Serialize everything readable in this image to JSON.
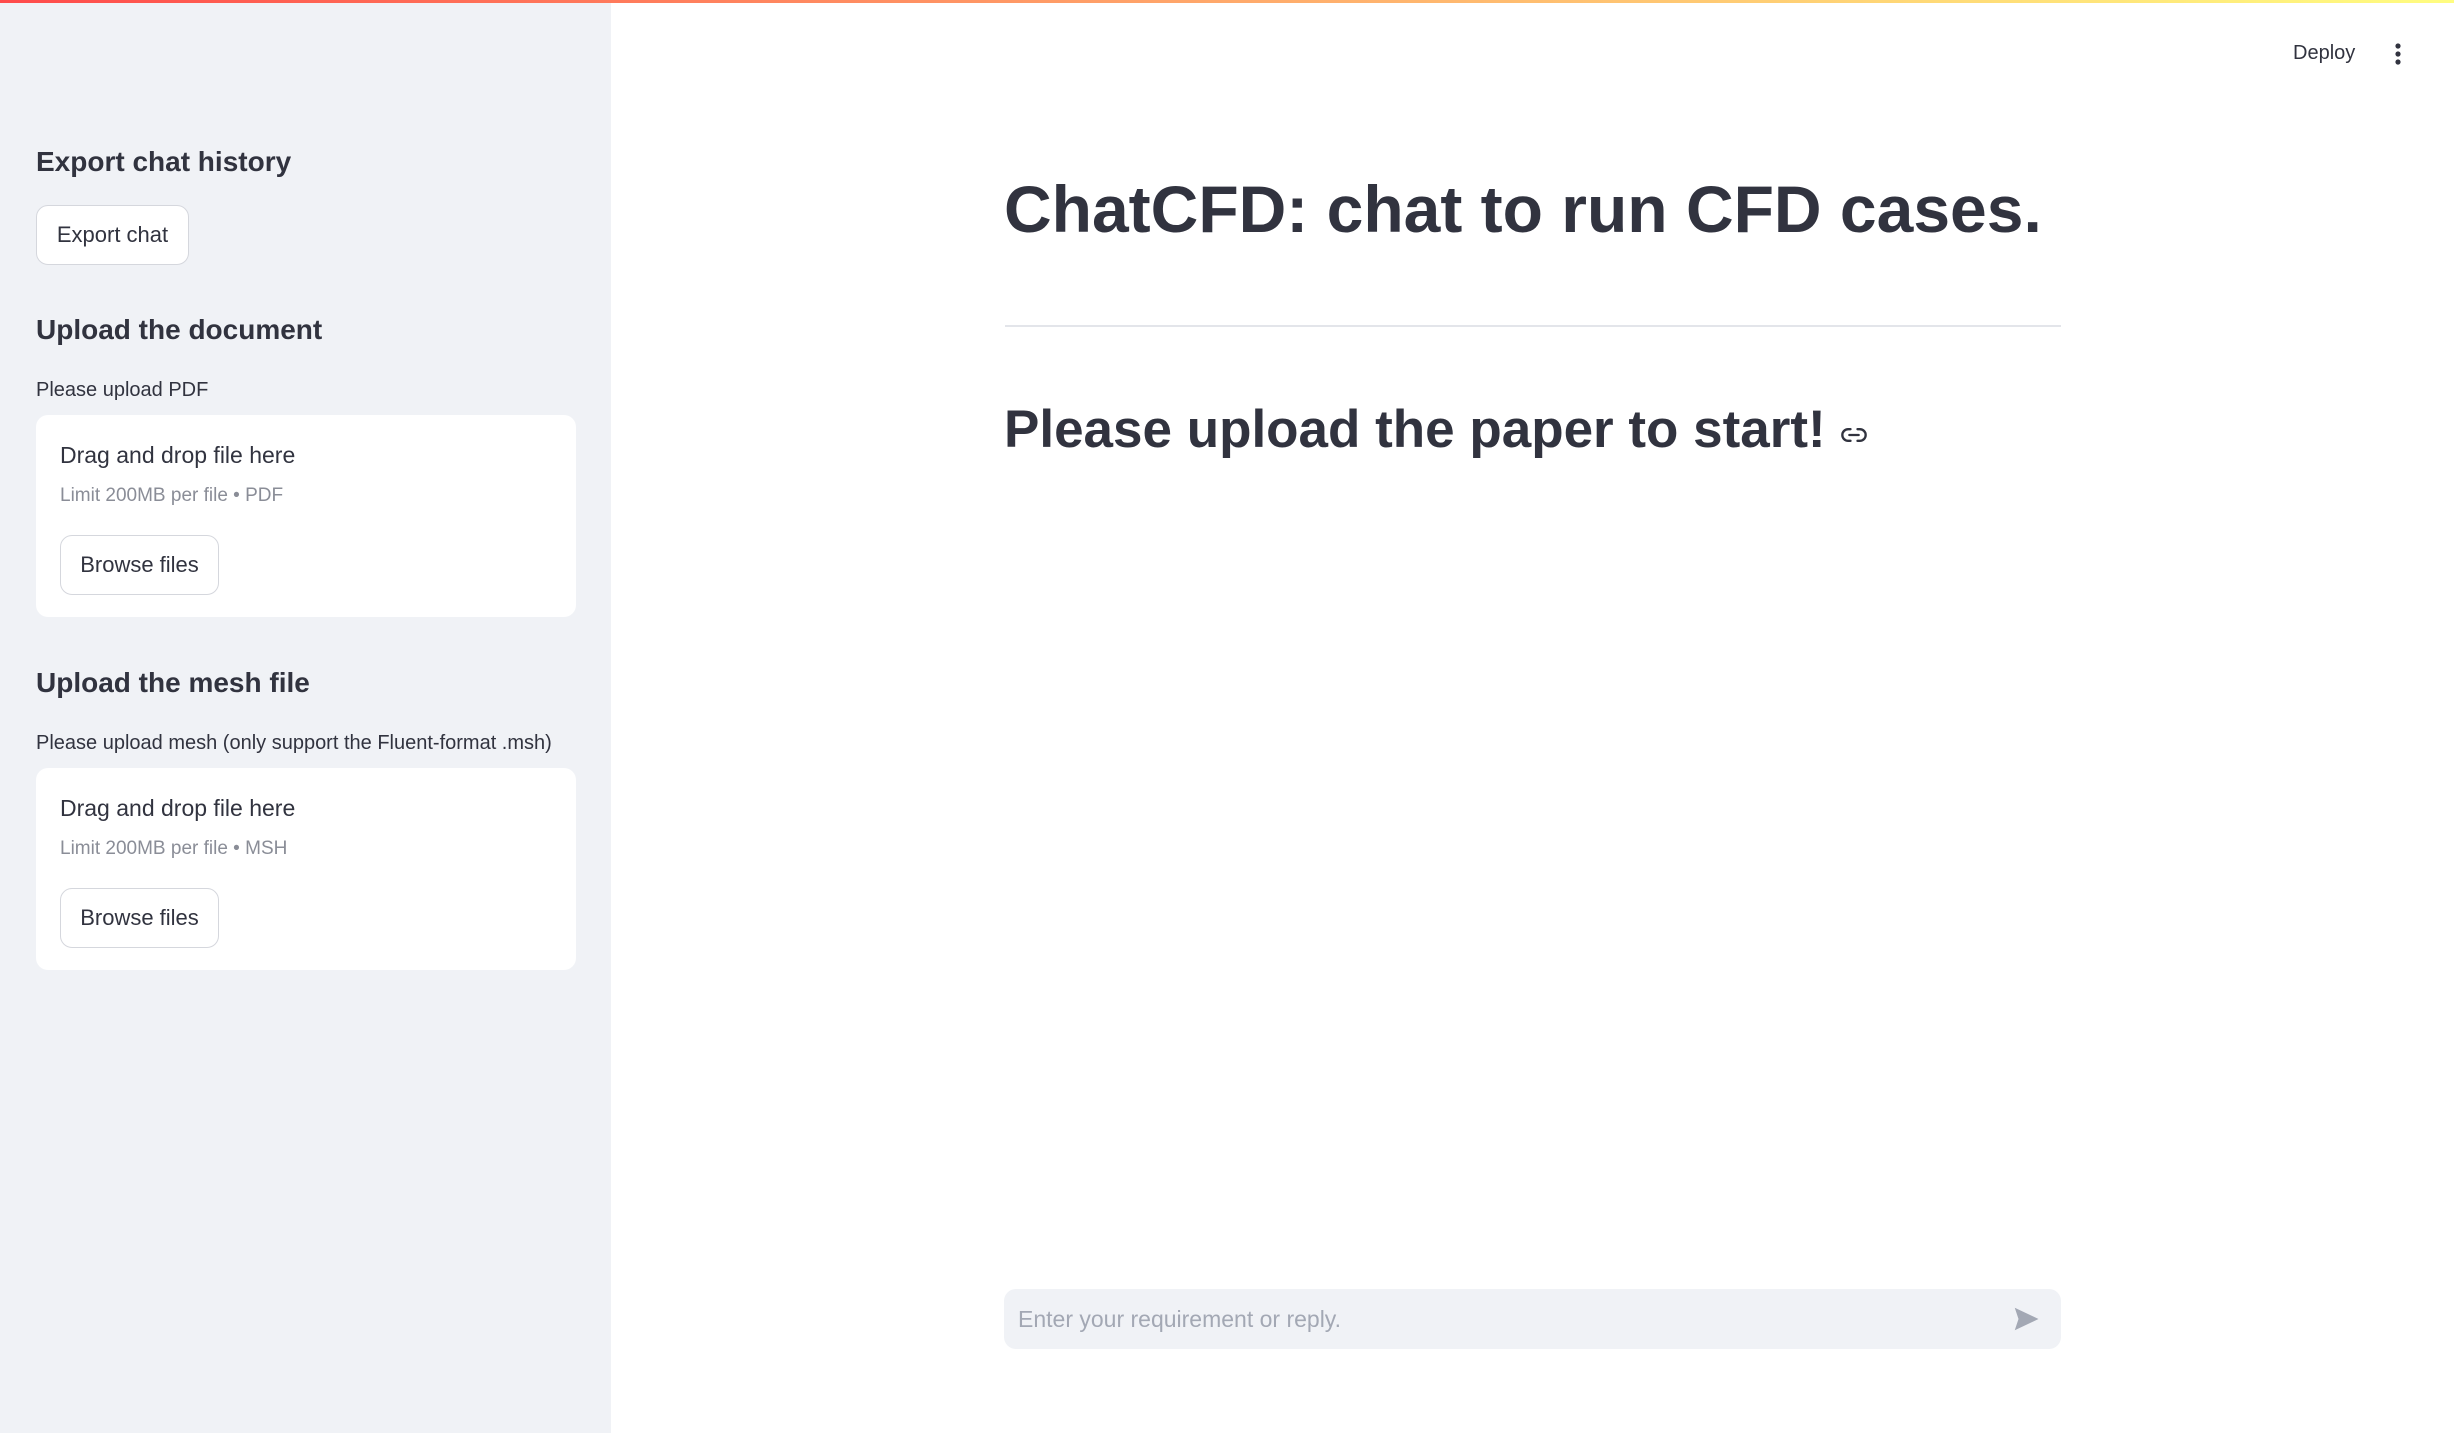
{
  "sidebar": {
    "export_heading": "Export chat history",
    "export_button": "Export chat",
    "document_heading": "Upload the document",
    "document_caption": "Please upload PDF",
    "document_dropzone": {
      "title": "Drag and drop file here",
      "limit": "Limit 200MB per file • PDF",
      "browse_label": "Browse files"
    },
    "mesh_heading": "Upload the mesh file",
    "mesh_caption": "Please upload mesh (only support the Fluent-format .msh)",
    "mesh_dropzone": {
      "title": "Drag and drop file here",
      "limit": "Limit 200MB per file • MSH",
      "browse_label": "Browse files"
    }
  },
  "header": {
    "deploy_label": "Deploy",
    "menu_icon": "kebab-vertical-icon"
  },
  "main": {
    "title": "ChatCFD: chat to run CFD cases.",
    "subtitle": "Please upload the paper to start!",
    "subtitle_icon": "link-icon"
  },
  "chat_input": {
    "placeholder": "Enter your requirement or reply.",
    "value": "",
    "send_icon": "send-icon"
  },
  "colors": {
    "sidebar_bg": "#f0f2f6",
    "text": "#31333f",
    "muted": "#8a8d97",
    "gradient_start": "#ff4b4b",
    "gradient_end": "#fffd80"
  }
}
